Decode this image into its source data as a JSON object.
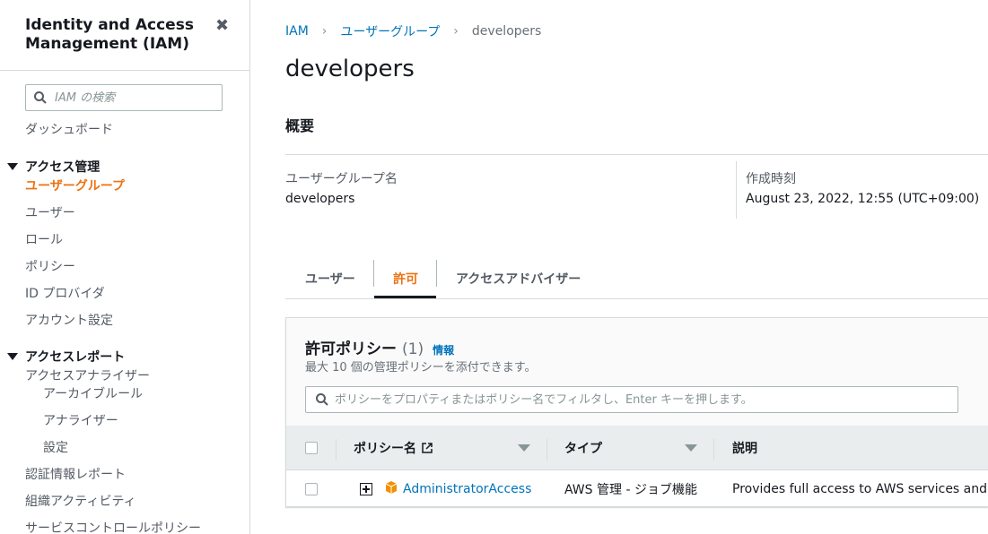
{
  "sidebar": {
    "title": "Identity and Access Management (IAM)",
    "close_icon": "close-icon",
    "search_placeholder": "IAM の検索",
    "dashboard": "ダッシュボード",
    "access_management": {
      "label": "アクセス管理",
      "items": [
        "ユーザーグループ",
        "ユーザー",
        "ロール",
        "ポリシー",
        "ID プロバイダ",
        "アカウント設定"
      ]
    },
    "access_reports": {
      "label": "アクセスレポート",
      "analyzer": "アクセスアナライザー",
      "sub_items": [
        "アーカイブルール",
        "アナライザー",
        "設定"
      ],
      "items": [
        "認証情報レポート",
        "組織アクティビティ",
        "サービスコントロールポリシー"
      ]
    }
  },
  "breadcrumb": {
    "items": [
      "IAM",
      "ユーザーグループ",
      "developers"
    ]
  },
  "page": {
    "title": "developers"
  },
  "summary": {
    "title": "概要",
    "group_name_label": "ユーザーグループ名",
    "group_name_value": "developers",
    "created_label": "作成時刻",
    "created_value": "August 23, 2022, 12:55 (UTC+09:00)"
  },
  "tabs": [
    "ユーザー",
    "許可",
    "アクセスアドバイザー"
  ],
  "active_tab": "許可",
  "policies": {
    "title": "許可ポリシー",
    "count": "(1)",
    "info": "情報",
    "description": "最大 10 個の管理ポリシーを添付できます。",
    "filter_placeholder": "ポリシーをプロパティまたはポリシー名でフィルタし、Enter キーを押します。",
    "columns": [
      "ポリシー名",
      "タイプ",
      "説明"
    ],
    "rows": [
      {
        "name": "AdministratorAccess",
        "type": "AWS 管理 - ジョブ機能",
        "description": "Provides full access to AWS services and reso"
      }
    ]
  },
  "colors": {
    "accent": "#ec7211",
    "link": "#0073bb",
    "text": "#16191f",
    "muted": "#545b64"
  }
}
